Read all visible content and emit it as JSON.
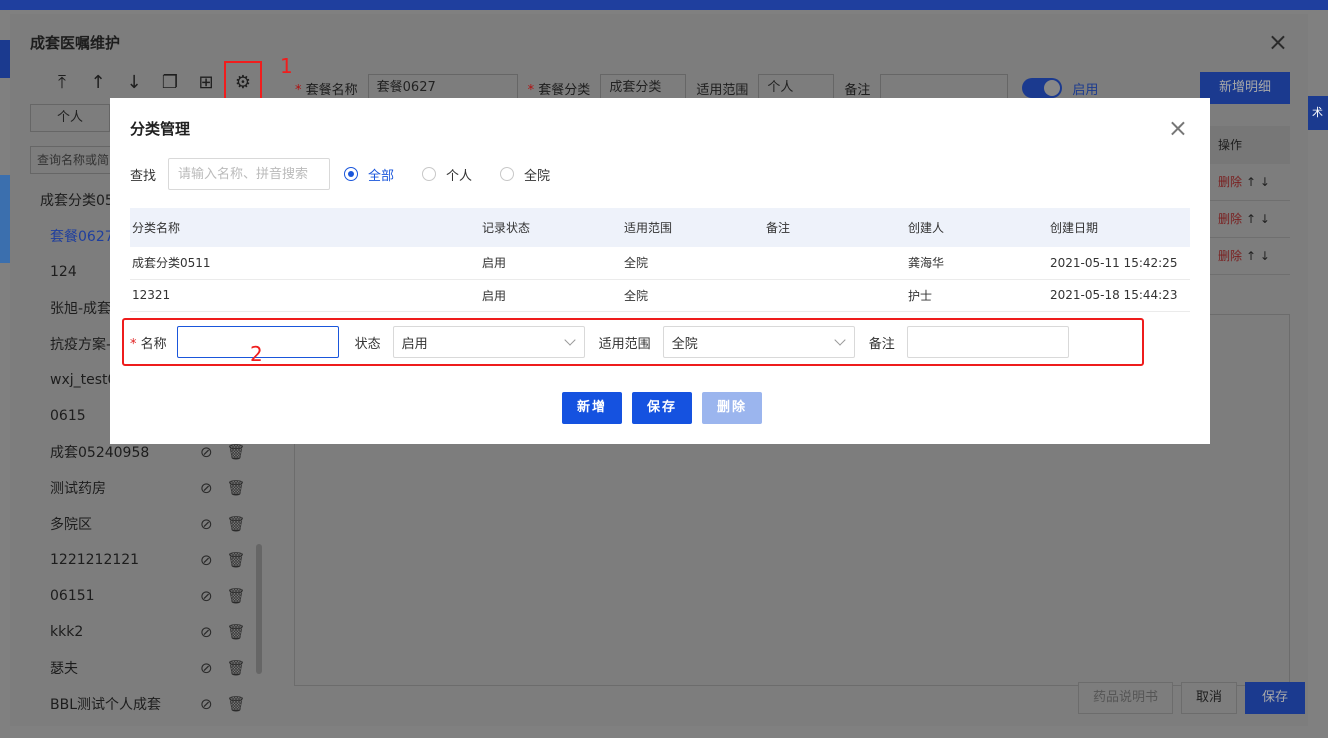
{
  "outer": {
    "title": "成套医嘱维护",
    "close": "×",
    "toolbar": {
      "annotation": "1"
    },
    "scope_tab": "个人",
    "search_placeholder": "查询名称或简",
    "list": [
      {
        "label": "成套分类05",
        "selected": false
      },
      {
        "label": "套餐0627",
        "selected": true
      },
      {
        "label": "124",
        "selected": false
      },
      {
        "label": "张旭-成套",
        "selected": false
      },
      {
        "label": "抗疫方案-",
        "selected": false
      },
      {
        "label": "wxj_test0",
        "selected": false
      },
      {
        "label": "0615",
        "selected": false
      },
      {
        "label": "成套05240958",
        "selected": false
      },
      {
        "label": "测试药房",
        "selected": false
      },
      {
        "label": "多院区",
        "selected": false
      },
      {
        "label": "1221212121",
        "selected": false
      },
      {
        "label": "06151",
        "selected": false
      },
      {
        "label": "kkk2",
        "selected": false
      },
      {
        "label": "瑟夫",
        "selected": false
      },
      {
        "label": "BBL测试个人成套",
        "selected": false
      }
    ],
    "header": {
      "name_label": "套餐名称",
      "name_value": "套餐0627",
      "cat_label": "套餐分类",
      "cat_value": "成套分类",
      "scope_label": "适用范围",
      "scope_value": "个人",
      "remark_label": "备注",
      "enabled_label": "启用",
      "new_detail": "新增明细"
    },
    "right_table": {
      "head": "操作",
      "rows": [
        "删除",
        "删除",
        "删除"
      ]
    },
    "footer": {
      "manual": "药品说明书",
      "cancel": "取消",
      "save": "保存"
    }
  },
  "modal": {
    "title": "分类管理",
    "close": "×",
    "search": {
      "label": "查找",
      "placeholder": "请输入名称、拼音搜索"
    },
    "radios": [
      {
        "label": "全部",
        "checked": true
      },
      {
        "label": "个人",
        "checked": false
      },
      {
        "label": "全院",
        "checked": false
      }
    ],
    "table": {
      "headers": [
        "分类名称",
        "记录状态",
        "适用范围",
        "备注",
        "创建人",
        "创建日期"
      ],
      "rows": [
        [
          "成套分类0511",
          "启用",
          "全院",
          "",
          "龚海华",
          "2021-05-11 15:42:25"
        ],
        [
          "12321",
          "启用",
          "全院",
          "",
          "护士",
          "2021-05-18 15:44:23"
        ]
      ]
    },
    "form": {
      "name_label": "名称",
      "status_label": "状态",
      "status_value": "启用",
      "scope_label": "适用范围",
      "scope_value": "全院",
      "remark_label": "备注",
      "annotation": "2"
    },
    "buttons": {
      "add": "新增",
      "save": "保存",
      "delete": "删除"
    }
  }
}
